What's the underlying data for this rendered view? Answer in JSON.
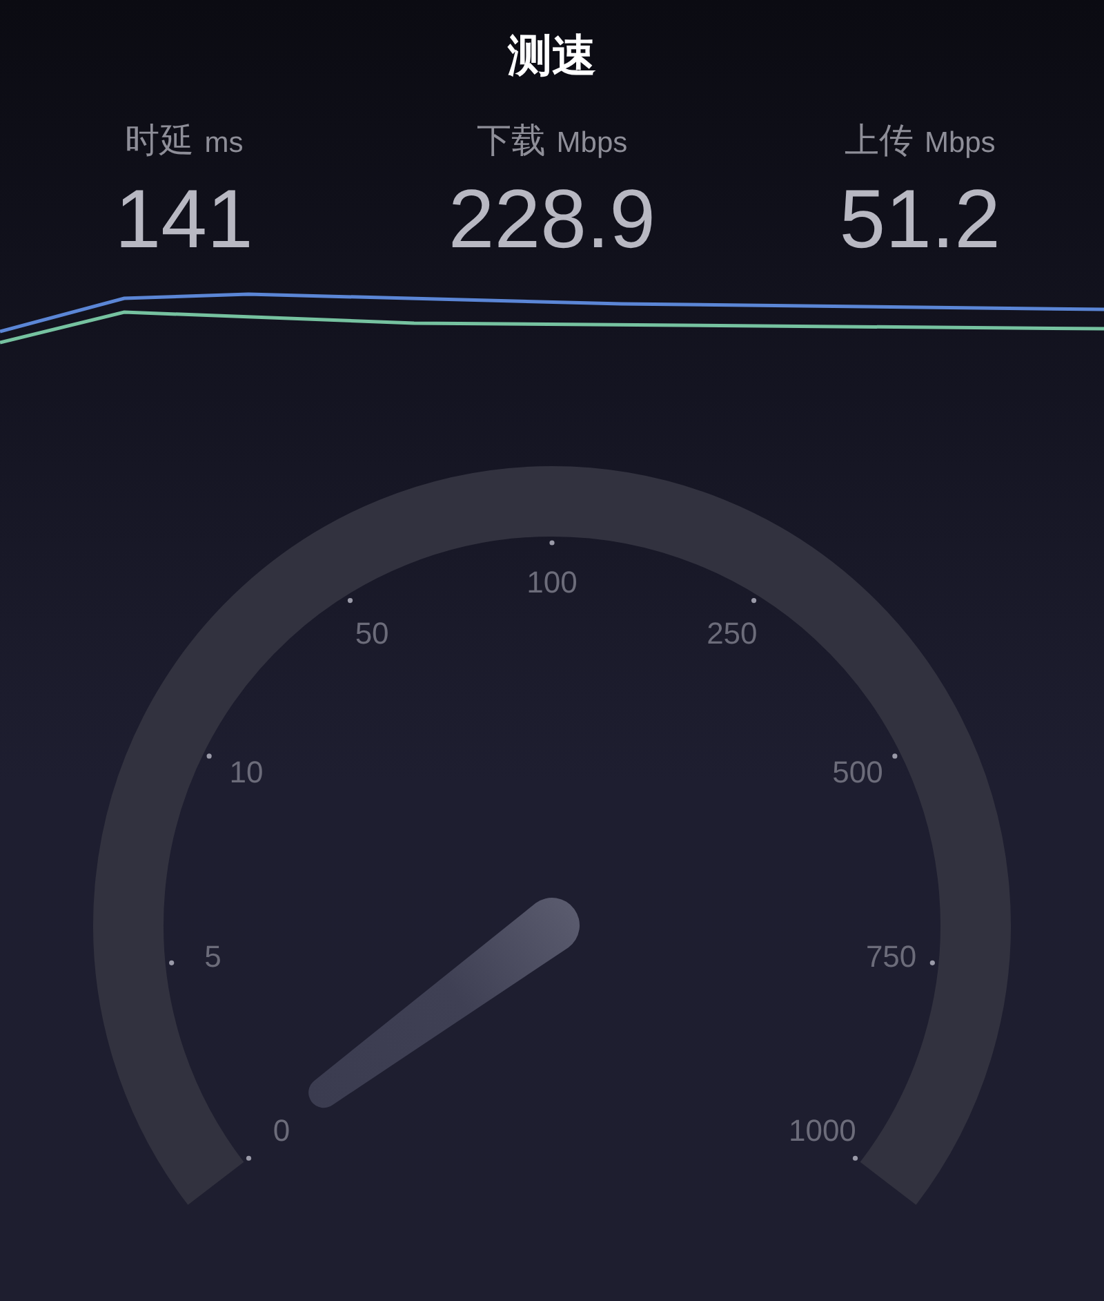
{
  "title": "测速",
  "stats": [
    {
      "label": "时延",
      "unit": "ms",
      "value": "141"
    },
    {
      "label": "下载",
      "unit": "Mbps",
      "value": "228.9"
    },
    {
      "label": "上传",
      "unit": "Mbps",
      "value": "51.2"
    }
  ],
  "gauge": {
    "ticks": [
      "0",
      "5",
      "10",
      "50",
      "100",
      "250",
      "500",
      "750",
      "1000"
    ]
  }
}
